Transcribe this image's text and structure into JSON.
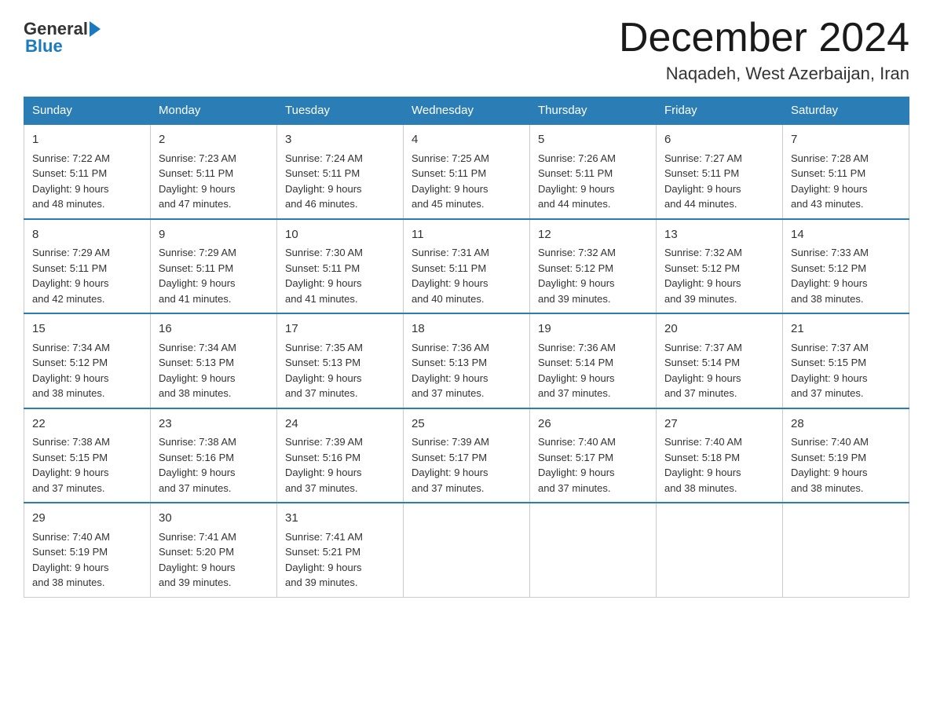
{
  "header": {
    "logo": {
      "general": "General",
      "blue": "Blue"
    },
    "title": "December 2024",
    "location": "Naqadeh, West Azerbaijan, Iran"
  },
  "days_of_week": [
    "Sunday",
    "Monday",
    "Tuesday",
    "Wednesday",
    "Thursday",
    "Friday",
    "Saturday"
  ],
  "weeks": [
    [
      {
        "day": "1",
        "sunrise": "7:22 AM",
        "sunset": "5:11 PM",
        "daylight": "9 hours and 48 minutes."
      },
      {
        "day": "2",
        "sunrise": "7:23 AM",
        "sunset": "5:11 PM",
        "daylight": "9 hours and 47 minutes."
      },
      {
        "day": "3",
        "sunrise": "7:24 AM",
        "sunset": "5:11 PM",
        "daylight": "9 hours and 46 minutes."
      },
      {
        "day": "4",
        "sunrise": "7:25 AM",
        "sunset": "5:11 PM",
        "daylight": "9 hours and 45 minutes."
      },
      {
        "day": "5",
        "sunrise": "7:26 AM",
        "sunset": "5:11 PM",
        "daylight": "9 hours and 44 minutes."
      },
      {
        "day": "6",
        "sunrise": "7:27 AM",
        "sunset": "5:11 PM",
        "daylight": "9 hours and 44 minutes."
      },
      {
        "day": "7",
        "sunrise": "7:28 AM",
        "sunset": "5:11 PM",
        "daylight": "9 hours and 43 minutes."
      }
    ],
    [
      {
        "day": "8",
        "sunrise": "7:29 AM",
        "sunset": "5:11 PM",
        "daylight": "9 hours and 42 minutes."
      },
      {
        "day": "9",
        "sunrise": "7:29 AM",
        "sunset": "5:11 PM",
        "daylight": "9 hours and 41 minutes."
      },
      {
        "day": "10",
        "sunrise": "7:30 AM",
        "sunset": "5:11 PM",
        "daylight": "9 hours and 41 minutes."
      },
      {
        "day": "11",
        "sunrise": "7:31 AM",
        "sunset": "5:11 PM",
        "daylight": "9 hours and 40 minutes."
      },
      {
        "day": "12",
        "sunrise": "7:32 AM",
        "sunset": "5:12 PM",
        "daylight": "9 hours and 39 minutes."
      },
      {
        "day": "13",
        "sunrise": "7:32 AM",
        "sunset": "5:12 PM",
        "daylight": "9 hours and 39 minutes."
      },
      {
        "day": "14",
        "sunrise": "7:33 AM",
        "sunset": "5:12 PM",
        "daylight": "9 hours and 38 minutes."
      }
    ],
    [
      {
        "day": "15",
        "sunrise": "7:34 AM",
        "sunset": "5:12 PM",
        "daylight": "9 hours and 38 minutes."
      },
      {
        "day": "16",
        "sunrise": "7:34 AM",
        "sunset": "5:13 PM",
        "daylight": "9 hours and 38 minutes."
      },
      {
        "day": "17",
        "sunrise": "7:35 AM",
        "sunset": "5:13 PM",
        "daylight": "9 hours and 37 minutes."
      },
      {
        "day": "18",
        "sunrise": "7:36 AM",
        "sunset": "5:13 PM",
        "daylight": "9 hours and 37 minutes."
      },
      {
        "day": "19",
        "sunrise": "7:36 AM",
        "sunset": "5:14 PM",
        "daylight": "9 hours and 37 minutes."
      },
      {
        "day": "20",
        "sunrise": "7:37 AM",
        "sunset": "5:14 PM",
        "daylight": "9 hours and 37 minutes."
      },
      {
        "day": "21",
        "sunrise": "7:37 AM",
        "sunset": "5:15 PM",
        "daylight": "9 hours and 37 minutes."
      }
    ],
    [
      {
        "day": "22",
        "sunrise": "7:38 AM",
        "sunset": "5:15 PM",
        "daylight": "9 hours and 37 minutes."
      },
      {
        "day": "23",
        "sunrise": "7:38 AM",
        "sunset": "5:16 PM",
        "daylight": "9 hours and 37 minutes."
      },
      {
        "day": "24",
        "sunrise": "7:39 AM",
        "sunset": "5:16 PM",
        "daylight": "9 hours and 37 minutes."
      },
      {
        "day": "25",
        "sunrise": "7:39 AM",
        "sunset": "5:17 PM",
        "daylight": "9 hours and 37 minutes."
      },
      {
        "day": "26",
        "sunrise": "7:40 AM",
        "sunset": "5:17 PM",
        "daylight": "9 hours and 37 minutes."
      },
      {
        "day": "27",
        "sunrise": "7:40 AM",
        "sunset": "5:18 PM",
        "daylight": "9 hours and 38 minutes."
      },
      {
        "day": "28",
        "sunrise": "7:40 AM",
        "sunset": "5:19 PM",
        "daylight": "9 hours and 38 minutes."
      }
    ],
    [
      {
        "day": "29",
        "sunrise": "7:40 AM",
        "sunset": "5:19 PM",
        "daylight": "9 hours and 38 minutes."
      },
      {
        "day": "30",
        "sunrise": "7:41 AM",
        "sunset": "5:20 PM",
        "daylight": "9 hours and 39 minutes."
      },
      {
        "day": "31",
        "sunrise": "7:41 AM",
        "sunset": "5:21 PM",
        "daylight": "9 hours and 39 minutes."
      },
      null,
      null,
      null,
      null
    ]
  ],
  "labels": {
    "sunrise_prefix": "Sunrise: ",
    "sunset_prefix": "Sunset: ",
    "daylight_prefix": "Daylight: "
  }
}
